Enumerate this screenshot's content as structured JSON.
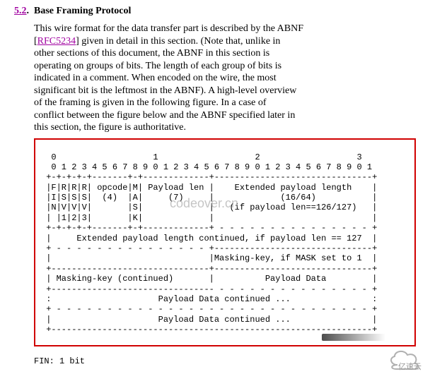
{
  "section": {
    "number": "5.2",
    "dot": ".",
    "title": "Base Framing Protocol"
  },
  "paragraph": {
    "t1": "This wire format for the data transfer part is described by the ABNF",
    "t2a": "[",
    "rfc": "RFC5234",
    "t2b": "] given in detail in this section.  (Note that, unlike in",
    "t3": "other sections of this document, the ABNF in this section is",
    "t4": "operating on groups of bits.  The length of each group of bits is",
    "t5": "indicated in a comment.  When encoded on the wire, the most",
    "t6": "significant bit is the leftmost in the ABNF).  A high-level overview",
    "t7": "of the framing is given in the following figure.  In a case of",
    "t8": "conflict between the figure below and the ABNF specified later in",
    "t9": "this section, the figure is authoritative."
  },
  "diagram": {
    "l01": "  0                   1                   2                   3",
    "l02": "  0 1 2 3 4 5 6 7 8 9 0 1 2 3 4 5 6 7 8 9 0 1 2 3 4 5 6 7 8 9 0 1",
    "l03": " +-+-+-+-+-------+-+-------------+-------------------------------+",
    "l04": " |F|R|R|R| opcode|M| Payload len |    Extended payload length    |",
    "l05": " |I|S|S|S|  (4)  |A|     (7)     |             (16/64)           |",
    "l06": " |N|V|V|V|       |S|             |   (if payload len==126/127)   |",
    "l07": " | |1|2|3|       |K|             |                               |",
    "l08": " +-+-+-+-+-------+-+-------------+ - - - - - - - - - - - - - - - +",
    "l09": " |     Extended payload length continued, if payload len == 127  |",
    "l10": " + - - - - - - - - - - - - - - - +-------------------------------+",
    "l11": " |                               |Masking-key, if MASK set to 1  |",
    "l12": " +-------------------------------+-------------------------------+",
    "l13": " | Masking-key (continued)       |          Payload Data         |",
    "l14": " +-------------------------------- - - - - - - - - - - - - - - - +",
    "l15": " :                     Payload Data continued ...                :",
    "l16": " + - - - - - - - - - - - - - - - - - - - - - - - - - - - - - - - +",
    "l17": " |                     Payload Data continued ...                |",
    "l18": " +---------------------------------------------------------------+"
  },
  "footer": {
    "fin": "FIN:  1 bit"
  },
  "watermark": {
    "center": "codeover.cn"
  },
  "branding": {
    "text": "亿速云"
  }
}
